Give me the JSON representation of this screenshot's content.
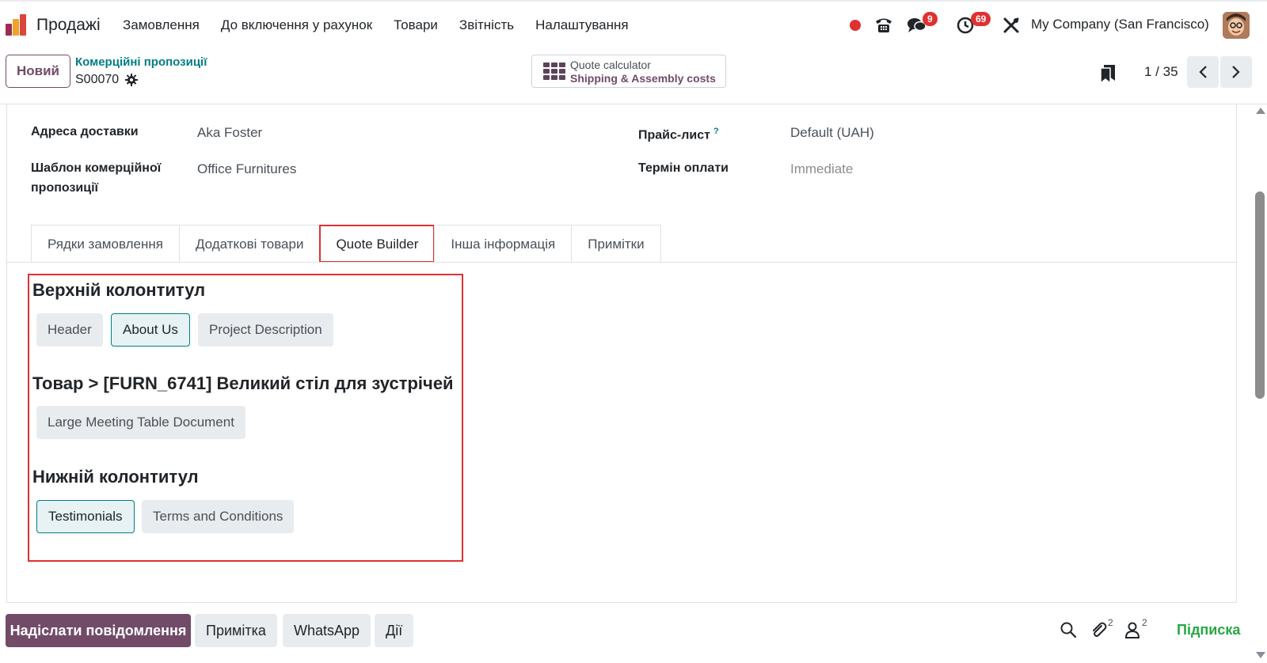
{
  "nav": {
    "app_name": "Продажі",
    "menu": [
      "Замовлення",
      "До включення у рахунок",
      "Товари",
      "Звітність",
      "Налаштування"
    ],
    "messages_badge": "9",
    "activities_badge": "69",
    "company": "My Company (San Francisco)"
  },
  "control": {
    "new_button": "Новий",
    "breadcrumb_parent": "Комерційні пропозиції",
    "record_name": "S00070",
    "quote_calc_line1": "Quote calculator",
    "quote_calc_line2": "Shipping & Assembly costs",
    "pager": "1 / 35"
  },
  "form": {
    "delivery_label": "Адреса доставки",
    "delivery_value": "Aka Foster",
    "template_label": "Шаблон комерційної пропозиції",
    "template_value": "Office Furnitures",
    "pricelist_label": "Прайс-лист",
    "pricelist_help": "?",
    "pricelist_value": "Default (UAH)",
    "payment_terms_label": "Термін оплати",
    "payment_terms_value": "Immediate"
  },
  "tabs": [
    "Рядки замовлення",
    "Додаткові товари",
    "Quote Builder",
    "Інша інформація",
    "Примітки"
  ],
  "active_tab_index": 2,
  "quote_builder": {
    "header_title": "Верхній колонтитул",
    "header_docs": [
      "Header",
      "About Us",
      "Project Description"
    ],
    "product_title": "Товар > [FURN_6741] Великий стіл для зустрічей",
    "product_docs": [
      "Large Meeting Table Document"
    ],
    "footer_title": "Нижній колонтитул",
    "footer_docs": [
      "Testimonials",
      "Terms and Conditions"
    ]
  },
  "chatter": {
    "send_message": "Надіслати повідомлення",
    "log_note": "Примітка",
    "whatsapp": "WhatsApp",
    "activities": "Дії",
    "attachments_count": "2",
    "followers_count": "2",
    "follow": "Підписка"
  },
  "colors": {
    "brand": "#714b67",
    "teal": "#017e84",
    "highlight": "#e03131"
  }
}
